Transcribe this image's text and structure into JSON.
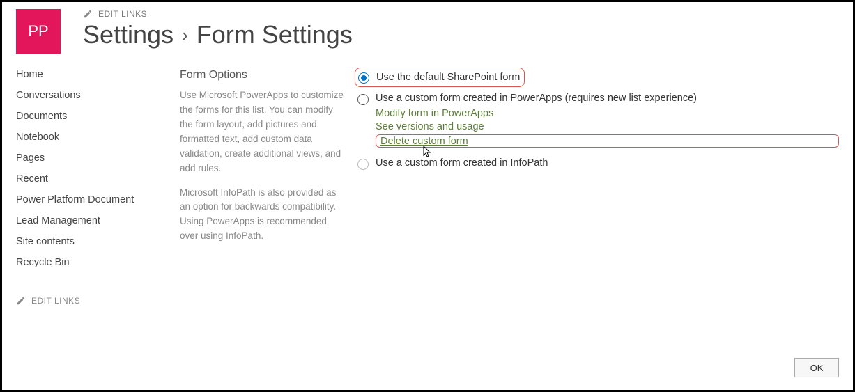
{
  "site": {
    "logo_text": "PP",
    "edit_links_label": "EDIT LINKS"
  },
  "breadcrumb": {
    "settings": "Settings",
    "separator": "›",
    "current": "Form Settings"
  },
  "quicklaunch": {
    "items": [
      "Home",
      "Conversations",
      "Documents",
      "Notebook",
      "Pages",
      "Recent",
      "Power Platform Document",
      "Lead Management",
      "Site contents",
      "Recycle Bin"
    ],
    "edit_links_label": "EDIT LINKS"
  },
  "form_options": {
    "title": "Form Options",
    "desc1": "Use Microsoft PowerApps to customize the forms for this list. You can modify the form layout, add pictures and formatted text, add custom data validation, create additional views, and add rules.",
    "desc2": "Microsoft InfoPath is also provided as an option for backwards compatibility. Using PowerApps is recommended over using InfoPath."
  },
  "options": {
    "default_label": "Use the default SharePoint form",
    "powerapps_label": "Use a custom form created in PowerApps (requires new list experience)",
    "powerapps_links": {
      "modify": "Modify form in PowerApps",
      "versions": "See versions and usage",
      "delete": "Delete custom form"
    },
    "infopath_label": "Use a custom form created in InfoPath",
    "selected": "default"
  },
  "footer": {
    "ok_label": "OK"
  }
}
